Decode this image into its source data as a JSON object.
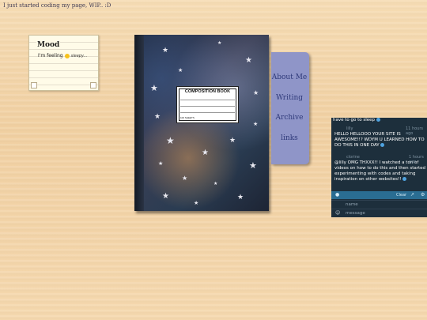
{
  "page": {
    "note": "I just started coding my page, WIP.. :D"
  },
  "mood": {
    "title": "Mood",
    "prefix": "I'm feeling",
    "status": "sleepy..."
  },
  "notebook": {
    "label_title": "COMPOSITION BOOK",
    "label_small": "100 SHEETS"
  },
  "nav": {
    "items": [
      "About Me",
      "Writing",
      "Archive",
      "links"
    ]
  },
  "chat": {
    "top_line": "have to go to sleep",
    "messages": [
      {
        "name": "lilly",
        "time": "11 hours ago",
        "text": "HELLO HELLOOO YOUR SITE IS AWESOME!!? WDYM U LEARNED HOW TO DO THIS IN ONE DAY"
      },
      {
        "name": "clorine",
        "time": "1 hours ago",
        "text": "@lilly OMG THXXX!! I watched a ton of videos on how to do this and then started experimenting with codes and taking inspiration on other websites!!"
      }
    ],
    "toolbar": {
      "clear": "Clear"
    },
    "name_placeholder": "name",
    "message_placeholder": "message"
  },
  "colors": {
    "tabs_bg": "#8f95c8",
    "tabs_text": "#2f3a7a",
    "chat_bg": "#1d2f3c",
    "chat_bar": "#2a6d92"
  }
}
